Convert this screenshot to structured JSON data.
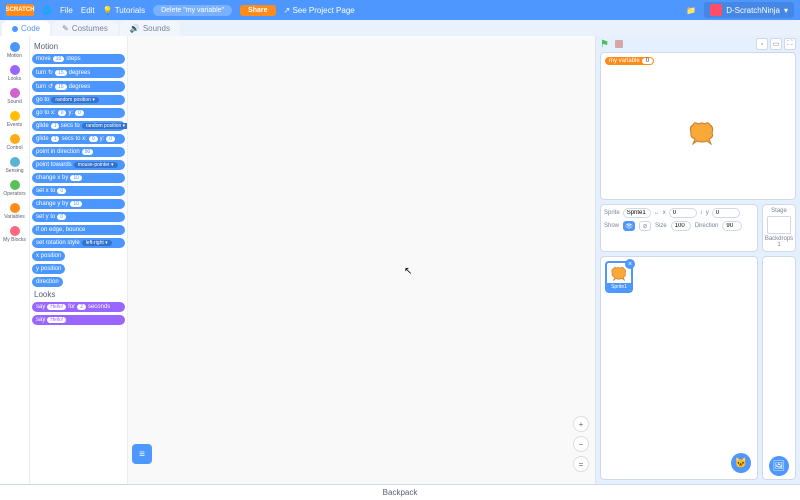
{
  "brand": "SCRATCH",
  "menu": {
    "file": "File",
    "edit": "Edit",
    "tutorials": "Tutorials"
  },
  "undo_label": "Delete \"my variable\"",
  "share": "Share",
  "see_project": "See Project Page",
  "username": "D-ScratchNinja",
  "tabs": {
    "code": "Code",
    "costumes": "Costumes",
    "sounds": "Sounds"
  },
  "categories": [
    {
      "name": "Motion",
      "color": "#4c97ff"
    },
    {
      "name": "Looks",
      "color": "#9966ff"
    },
    {
      "name": "Sound",
      "color": "#cf63cf"
    },
    {
      "name": "Events",
      "color": "#ffbf00"
    },
    {
      "name": "Control",
      "color": "#ffab19"
    },
    {
      "name": "Sensing",
      "color": "#5cb1d6"
    },
    {
      "name": "Operators",
      "color": "#59c059"
    },
    {
      "name": "Variables",
      "color": "#ff8c1a"
    },
    {
      "name": "My Blocks",
      "color": "#ff6680"
    }
  ],
  "palette": {
    "motion_header": "Motion",
    "blocks": [
      {
        "pre": "move",
        "val": "10",
        "post": "steps"
      },
      {
        "pre": "turn ↻",
        "val": "15",
        "post": "degrees"
      },
      {
        "pre": "turn ↺",
        "val": "15",
        "post": "degrees"
      },
      {
        "pre": "go to",
        "dd": "random position ▾"
      },
      {
        "pre": "go to x:",
        "val": "0",
        "mid": "y:",
        "val2": "0"
      },
      {
        "pre": "glide",
        "val": "1",
        "mid": "secs to",
        "dd": "random position ▾"
      },
      {
        "pre": "glide",
        "val": "1",
        "mid": "secs to x:",
        "val2": "0",
        "mid2": "y:",
        "val3": "0"
      },
      {
        "pre": "point in direction",
        "val": "90"
      },
      {
        "pre": "point towards",
        "dd": "mouse-pointer ▾"
      },
      {
        "pre": "change x by",
        "val": "10"
      },
      {
        "pre": "set x to",
        "val": "0"
      },
      {
        "pre": "change y by",
        "val": "10"
      },
      {
        "pre": "set y to",
        "val": "0"
      },
      {
        "pre": "if on edge, bounce"
      },
      {
        "pre": "set rotation style",
        "dd": "left-right ▾"
      },
      {
        "reporter": "x position"
      },
      {
        "reporter": "y position"
      },
      {
        "reporter": "direction"
      }
    ],
    "looks_header": "Looks",
    "looks_blocks": [
      {
        "pre": "say",
        "val": "Hello!",
        "mid": "for",
        "val2": "2",
        "post": "seconds"
      },
      {
        "pre": "say",
        "val": "Hello!"
      }
    ]
  },
  "stage": {
    "variable_name": "my variable",
    "variable_value": "0"
  },
  "sprite_info": {
    "label": "Sprite",
    "name": "Sprite1",
    "x_label": "x",
    "x": "0",
    "y_label": "y",
    "y": "0",
    "show_label": "Show",
    "size_label": "Size",
    "size": "100",
    "dir_label": "Direction",
    "dir": "90"
  },
  "stage_panel": {
    "label": "Stage",
    "backdrops_label": "Backdrops",
    "backdrops_count": "1"
  },
  "sprite_card": {
    "name": "Sprite1"
  },
  "backpack": "Backpack",
  "icons": {
    "globe": "🌐",
    "folder": "📁",
    "flag": "⚑",
    "picture": "🖼",
    "cat": "🐱",
    "fullscreen": "⛶",
    "smallstage": "▫",
    "largestage": "▭",
    "plus": "+",
    "minus": "−",
    "center": "=",
    "ext": "≡"
  }
}
